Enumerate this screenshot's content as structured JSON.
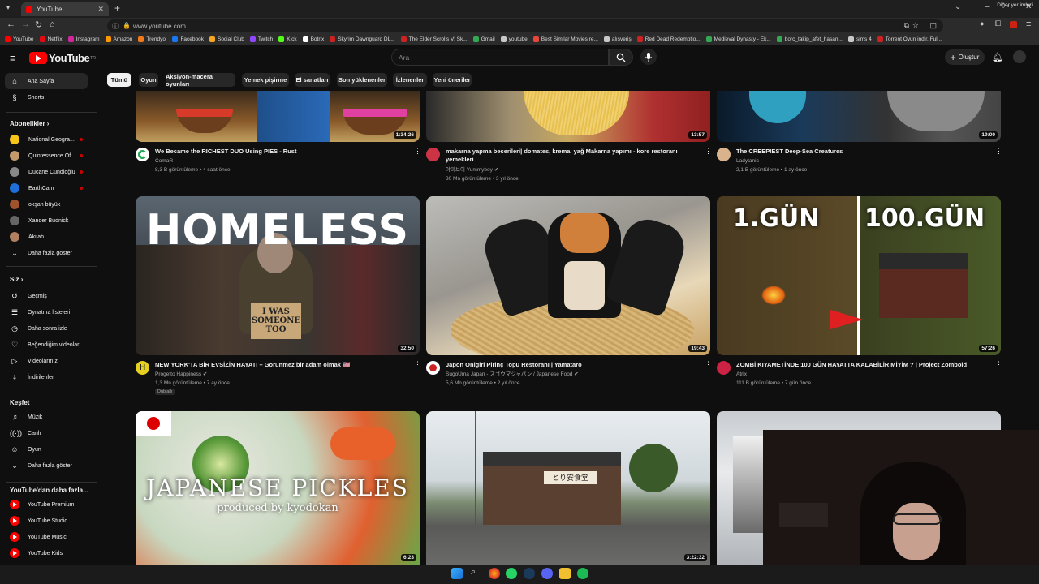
{
  "browser": {
    "tab_title": "YouTube",
    "url": "www.youtube.com",
    "bookmarks": [
      {
        "label": "YouTube",
        "color": "#ff0000"
      },
      {
        "label": "Netflix",
        "color": "#e50914"
      },
      {
        "label": "Instagram",
        "color": "#d6249f"
      },
      {
        "label": "Amazon",
        "color": "#ff9900"
      },
      {
        "label": "Trendyol",
        "color": "#f27a1a"
      },
      {
        "label": "Facebook",
        "color": "#1877f2"
      },
      {
        "label": "Social Club",
        "color": "#f5a623"
      },
      {
        "label": "Twitch",
        "color": "#9146ff"
      },
      {
        "label": "Kick",
        "color": "#53fc18"
      },
      {
        "label": "Botrix",
        "color": "#ffffff"
      },
      {
        "label": "Skyrim Dawnguard DL...",
        "color": "#cc2222"
      },
      {
        "label": "The Elder Scrolls V: Sk...",
        "color": "#cc2222"
      },
      {
        "label": "Gmail",
        "color": "#34a853"
      },
      {
        "label": "youtube",
        "color": "#c8c8c8"
      },
      {
        "label": "Best Similar Movies re...",
        "color": "#e8453c"
      },
      {
        "label": "alışveriş",
        "color": "#c8c8c8"
      },
      {
        "label": "Red Dead Redemptio...",
        "color": "#cc2222"
      },
      {
        "label": "Medieval Dynasty - Ek...",
        "color": "#34a853"
      },
      {
        "label": "borc_takip_afet_hasan...",
        "color": "#34a853"
      },
      {
        "label": "sims 4",
        "color": "#c8c8c8"
      },
      {
        "label": "Torrent Oyun indir, Ful...",
        "color": "#cc2222"
      }
    ],
    "other_bookmarks": "Diğer yer imleri"
  },
  "header": {
    "logo_text": "YouTube",
    "logo_sup": "TR",
    "search_placeholder": "Ara",
    "create_label": "Oluştur"
  },
  "chips": [
    "Tümü",
    "Oyun",
    "Aksiyon-macera oyunları",
    "Yemek pişirme",
    "El sanatları",
    "Son yüklenenler",
    "İzlenenler",
    "Yeni öneriler"
  ],
  "sidebar": {
    "home": "Ana Sayfa",
    "shorts": "Shorts",
    "subs_heading": "Abonelikler",
    "subs": [
      {
        "name": "National Geogra...",
        "color": "#f5c518"
      },
      {
        "name": "Quintessence Of ...",
        "color": "#c49a6c"
      },
      {
        "name": "Dücane Cündioğlu",
        "color": "#888888"
      },
      {
        "name": "EarthCam",
        "color": "#1e6fd9"
      },
      {
        "name": "okşan büyük",
        "color": "#a0522d"
      },
      {
        "name": "Xander Budnick",
        "color": "#666666"
      },
      {
        "name": "Akilah",
        "color": "#b08060"
      }
    ],
    "show_more": "Daha fazla göster",
    "you_heading": "Siz",
    "you_items": [
      "Geçmiş",
      "Oynatma listeleri",
      "Daha sonra izle",
      "Beğendiğim videolar",
      "Videolarınız",
      "İndirilenler"
    ],
    "explore_heading": "Keşfet",
    "explore_items": [
      "Müzik",
      "Canlı",
      "Oyun",
      "Daha fazla göster"
    ],
    "more_heading": "YouTube'dan daha fazla...",
    "more_items": [
      "YouTube Premium",
      "YouTube Studio",
      "YouTube Music",
      "YouTube Kids"
    ]
  },
  "videos_row1": [
    {
      "title": "We Became the RICHEST DUO Using PIES - Rust",
      "channel": "ComaR",
      "stats": "8,3 B görüntüleme • 4 saat önce",
      "duration": "1:34:26",
      "avatar": "#22aa55"
    },
    {
      "title": "makarna yapma becerileri| domates, krema, yağ Makarna yapımı - kore restoranı yemekleri",
      "channel": "야미보이 Yummyboy",
      "stats": "30 Mn görüntüleme • 3 yıl önce",
      "duration": "13:57",
      "avatar": "#cc3344"
    },
    {
      "title": "The CREEPIEST Deep-Sea Creatures",
      "channel": "Ladytanic",
      "stats": "2,1 B görüntüleme • 1 ay önce",
      "duration": "19:00",
      "avatar": "#d9b38c"
    }
  ],
  "videos_row2": [
    {
      "title": "NEW YORK'TA BİR EVSİZİN HAYATI – Görünmez bir adam olmak 🇺🇸",
      "channel": "Progetto Happiness",
      "stats": "1,3 Mn görüntüleme • 7 ay önce",
      "duration": "32:50",
      "avatar": "#e6d020",
      "overlay": "HOMELESS",
      "sign": "I WAS SOMEONE TOO",
      "badge": "Dublajlı"
    },
    {
      "title": "Japon Onigiri Pirinç Topu Restoranı | Yamataro",
      "channel": "SugoUma Japan - スゴウマジャパン / Japanese Food",
      "stats": "5,6 Mn görüntüleme • 2 yıl önce",
      "duration": "19:43",
      "avatar": "#ffffff"
    },
    {
      "title": "ZOMBİ KIYAMETİNDE 100 GÜN HAYATTA KALABİLİR MİYİM ? | Project Zomboid",
      "channel": "Atrix",
      "stats": "111 B görüntüleme • 7 gün önce",
      "duration": "57:26",
      "avatar": "#cc2244",
      "left_text": "1.GÜN",
      "right_text": "100.GÜN"
    }
  ],
  "videos_row3": [
    {
      "duration": "6:23",
      "line1": "JAPANESE PICKLES",
      "line2": "produced by kyodokan"
    },
    {
      "duration": "3:22:32",
      "sign": "とり安食堂"
    },
    {
      "duration": ""
    }
  ]
}
